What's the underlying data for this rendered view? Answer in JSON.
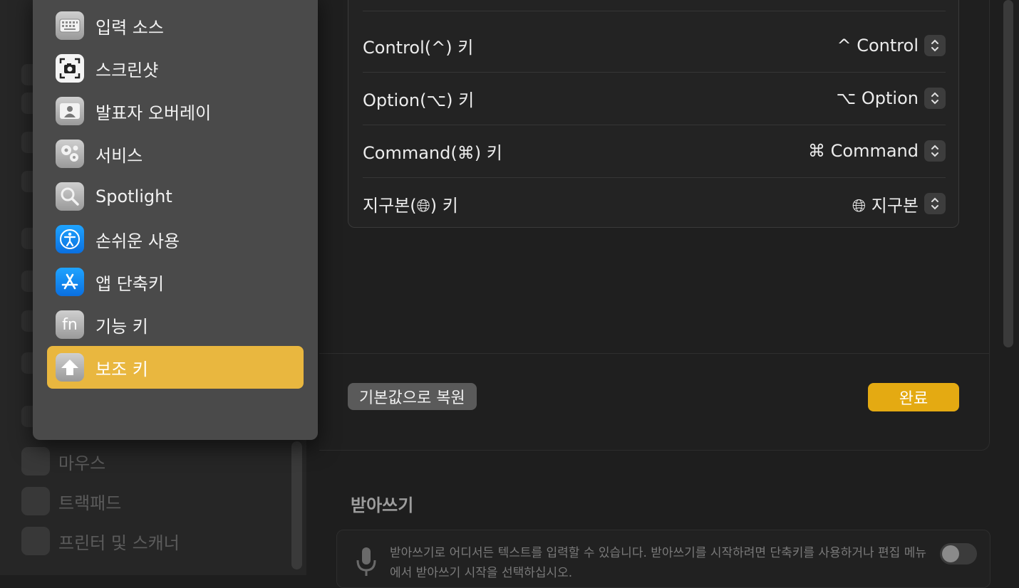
{
  "background": {
    "sidebar_items": [
      {
        "label": "마우스",
        "icon": "mouse-icon"
      },
      {
        "label": "트랙패드",
        "icon": "trackpad-icon"
      },
      {
        "label": "프린터 및 스캐너",
        "icon": "printer-icon"
      }
    ]
  },
  "menu": {
    "selected_color": "#e9b73f",
    "items": [
      {
        "label": "입력 소스",
        "icon": "keyboard-icon"
      },
      {
        "label": "스크린샷",
        "icon": "screenshot-icon"
      },
      {
        "label": "발표자 오버레이",
        "icon": "presenter-overlay-icon"
      },
      {
        "label": "서비스",
        "icon": "gears-icon"
      },
      {
        "label": "Spotlight",
        "icon": "magnifier-icon"
      },
      {
        "label": "손쉬운 사용",
        "icon": "accessibility-icon"
      },
      {
        "label": "앱 단축키",
        "icon": "app-store-icon"
      },
      {
        "label": "기능 키",
        "icon": "fn-icon",
        "icon_text": "fn"
      },
      {
        "label": "보조 키",
        "icon": "modifier-arrow-icon",
        "selected": true
      }
    ]
  },
  "modifier_keys": {
    "rows": [
      {
        "label": "Control(^) 키",
        "value": "^ Control"
      },
      {
        "label": "Option(⌥) 키",
        "value": "⌥ Option"
      },
      {
        "label": "Command(⌘) 키",
        "value": "⌘ Command"
      },
      {
        "label": "지구본(🌐︎) 키",
        "value": "🌐︎ 지구본"
      }
    ]
  },
  "buttons": {
    "restore_defaults": "기본값으로 복원",
    "done": "완료",
    "accent": "#e4aa12"
  },
  "dictation": {
    "title": "받아쓰기",
    "description": "받아쓰기로 어디서든 텍스트를 입력할 수 있습니다. 받아쓰기를 시작하려면 단축키를 사용하거나 편집 메뉴에서 받아쓰기 시작을 선택하십시오.",
    "enabled": false
  }
}
